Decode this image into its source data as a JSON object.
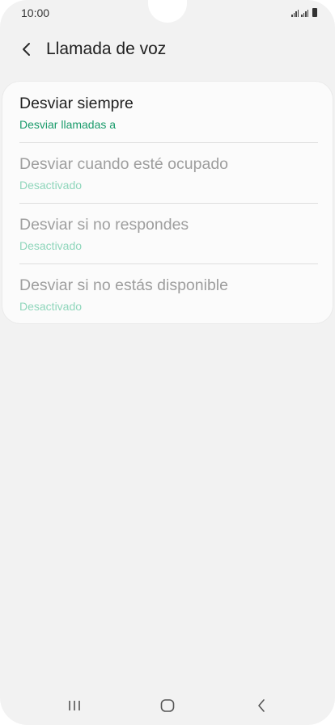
{
  "status_bar": {
    "time": "10:00",
    "icons": [
      "signal-icon",
      "signal-icon",
      "battery-icon"
    ]
  },
  "header": {
    "back_icon": "chevron-left-icon",
    "title": "Llamada de voz"
  },
  "options": [
    {
      "title": "Desviar siempre",
      "subtitle": "Desviar llamadas a",
      "enabled": true
    },
    {
      "title": "Desviar cuando esté ocupado",
      "subtitle": "Desactivado",
      "enabled": false
    },
    {
      "title": "Desviar si no respondes",
      "subtitle": "Desactivado",
      "enabled": false
    },
    {
      "title": "Desviar si no estás disponible",
      "subtitle": "Desactivado",
      "enabled": false
    }
  ],
  "navigation_bar": {
    "icons": [
      "recent-apps-icon",
      "home-icon",
      "back-icon"
    ]
  },
  "colors": {
    "background": "#f2f2f2",
    "card": "#fbfbfb",
    "accent_green": "#1a9b6b",
    "disabled_green": "#8fd6bb",
    "disabled_text": "#9e9e9e"
  }
}
